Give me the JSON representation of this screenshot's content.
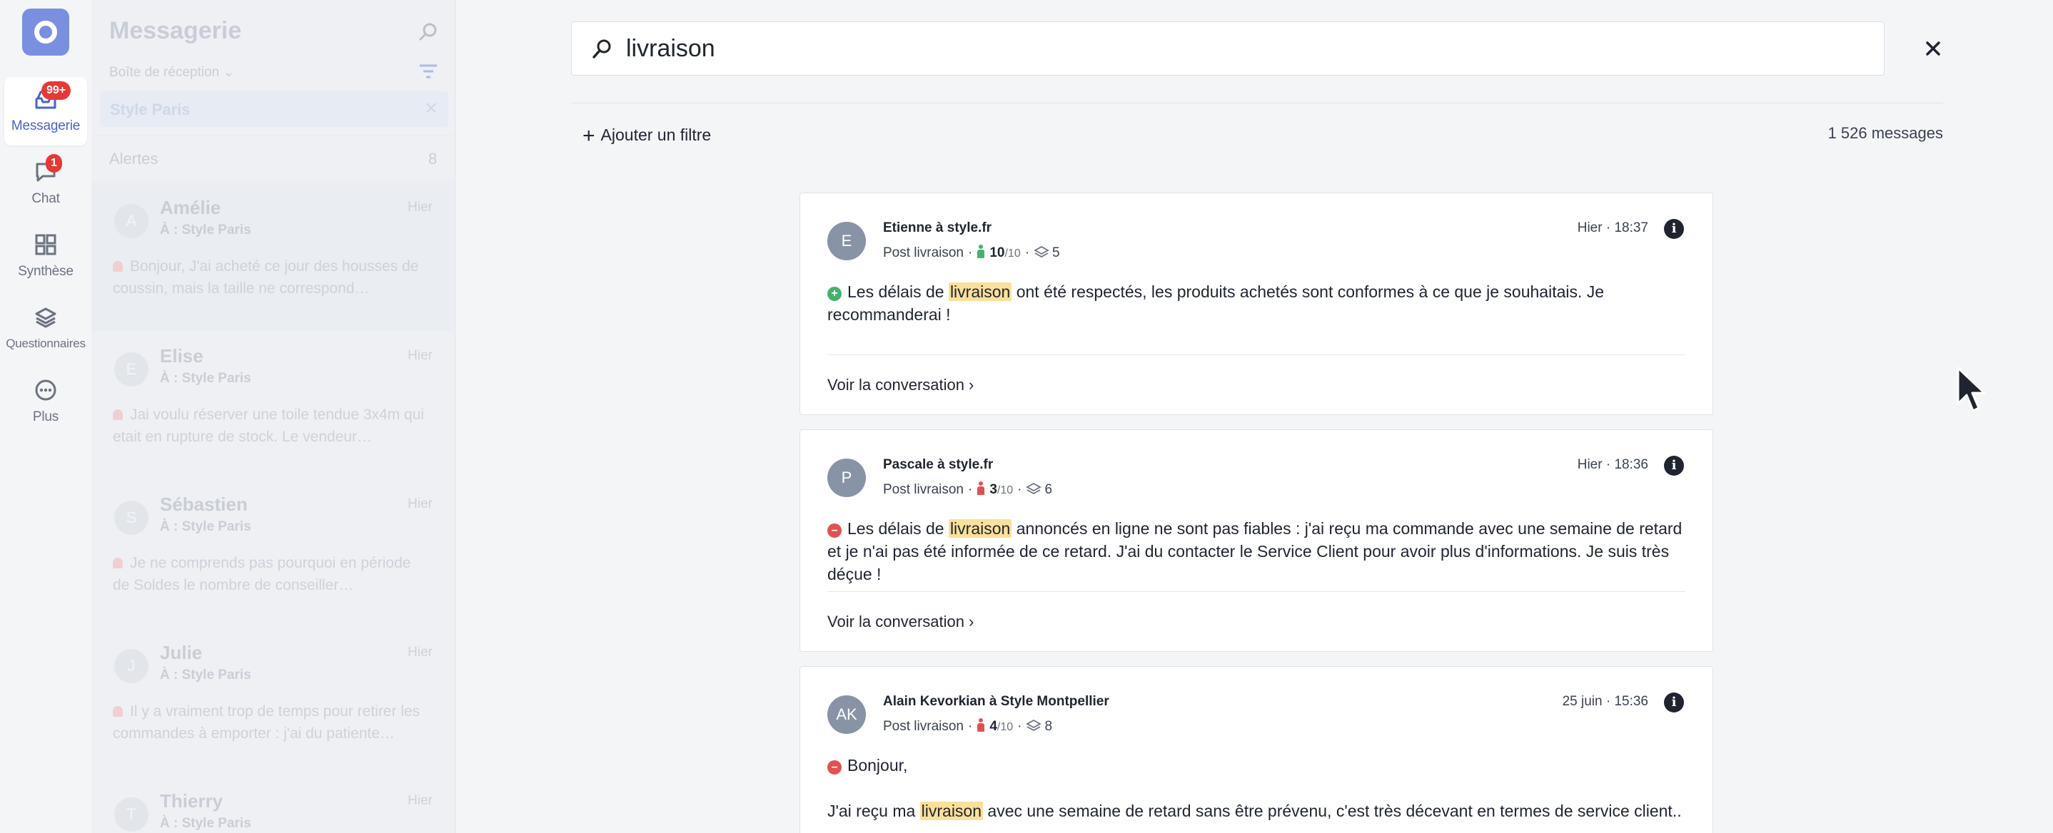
{
  "rail": {
    "items": [
      {
        "label": "Messagerie",
        "badge": "99+"
      },
      {
        "label": "Chat",
        "badge": "1"
      },
      {
        "label": "Synthèse"
      },
      {
        "label": "Questionnaires"
      },
      {
        "label": "Plus"
      }
    ]
  },
  "panel": {
    "title": "Messagerie",
    "inbox_label": "Boîte de réception ⌄",
    "filter_chip": "Style Paris",
    "alerts_label": "Alertes",
    "alerts_count": "8",
    "conversations": [
      {
        "initial": "A",
        "name": "Amélie",
        "time": "Hier",
        "to": "À : Style Paris",
        "preview": "Bonjour, J'ai acheté ce jour des housses de coussin, mais la taille ne correspond…"
      },
      {
        "initial": "E",
        "name": "Elise",
        "time": "Hier",
        "to": "À : Style Paris",
        "preview": "Jai voulu réserver une toile tendue 3x4m qui etait en rupture de stock. Le vendeur…"
      },
      {
        "initial": "S",
        "name": "Sébastien",
        "time": "Hier",
        "to": "À : Style Paris",
        "preview": "Je ne comprends pas pourquoi en période de Soldes le nombre de conseiller…"
      },
      {
        "initial": "J",
        "name": "Julie",
        "time": "Hier",
        "to": "À : Style Paris",
        "preview": "Il y a vraiment trop de temps pour retirer les commandes à emporter : j'ai du patiente…"
      },
      {
        "initial": "T",
        "name": "Thierry",
        "time": "Hier",
        "to": "À : Style Paris",
        "preview": ""
      }
    ]
  },
  "search": {
    "query": "livraison",
    "add_filter": "Ajouter un filtre",
    "count": "1 526 messages"
  },
  "results": [
    {
      "initials": "E",
      "author": "Etienne à style.fr",
      "source": "Post livraison",
      "score": "10",
      "score_den": "/10",
      "score_color": "#43b36b",
      "layers": "5",
      "time": "Hier · 18:37",
      "sentiment": "positive",
      "text_before": "Les délais de ",
      "highlight": "livraison",
      "text_after": " ont été respectés, les produits achetés sont conformes à ce que je souhaitais. Je recommanderai !",
      "view_label": "Voir la conversation"
    },
    {
      "initials": "P",
      "author": "Pascale à style.fr",
      "source": "Post livraison",
      "score": "3",
      "score_den": "/10",
      "score_color": "#e05252",
      "layers": "6",
      "time": "Hier · 18:36",
      "sentiment": "negative",
      "text_before": "Les délais de ",
      "highlight": "livraison",
      "text_after": " annoncés en ligne ne sont pas fiables : j'ai reçu ma commande avec une semaine de retard et je n'ai pas été informée de ce retard. J'ai du contacter le Service Client pour avoir plus d'informations. Je suis très déçue !",
      "view_label": "Voir la conversation"
    },
    {
      "initials": "AK",
      "author": "Alain Kevorkian à Style Montpellier",
      "source": "Post livraison",
      "score": "4",
      "score_den": "/10",
      "score_color": "#e05252",
      "layers": "8",
      "time": "25 juin · 15:36",
      "sentiment": "negative",
      "greeting": "Bonjour,",
      "text_before": "J'ai reçu ma ",
      "highlight": "livraison",
      "text_after": " avec une semaine de retard sans être prévenu, c'est très décevant en termes de service client.."
    }
  ],
  "colors": {
    "accent": "#4a63c9",
    "badge": "#e53935",
    "highlight": "#fbe09a",
    "positive": "#43b36b",
    "negative": "#e05252"
  }
}
